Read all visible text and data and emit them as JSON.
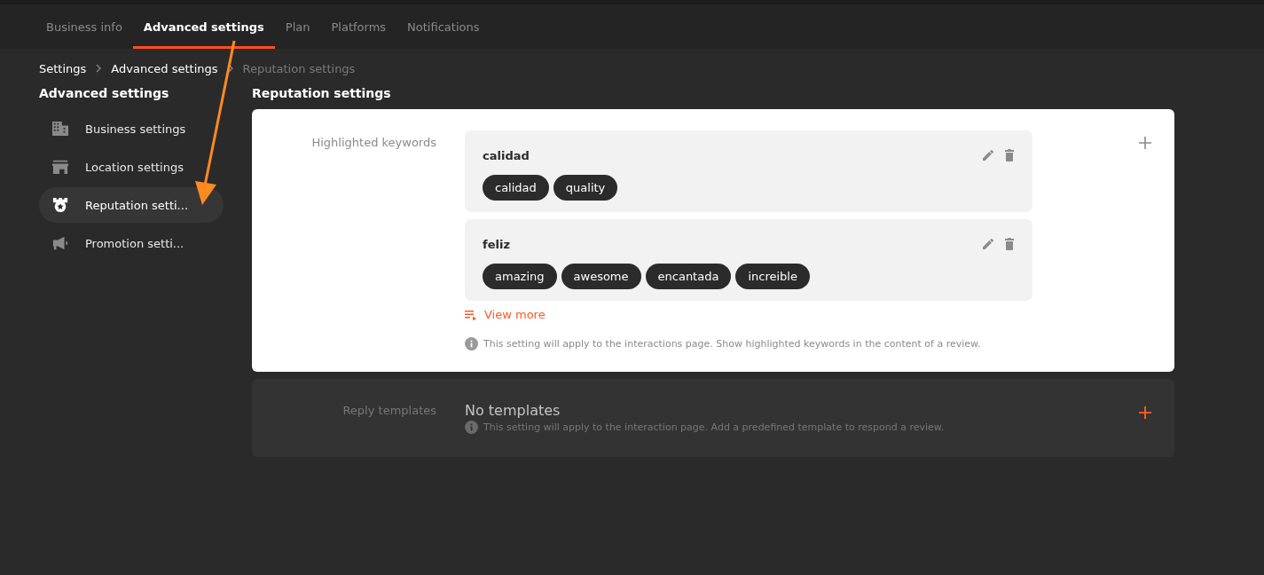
{
  "tabs": [
    {
      "label": "Business info",
      "selected": false
    },
    {
      "label": "Advanced settings",
      "selected": true
    },
    {
      "label": "Plan",
      "selected": false
    },
    {
      "label": "Platforms",
      "selected": false
    },
    {
      "label": "Notifications",
      "selected": false
    }
  ],
  "breadcrumb": [
    "Settings",
    "Advanced settings",
    "Reputation settings"
  ],
  "sidebar": {
    "title": "Advanced settings",
    "items": [
      {
        "label": "Business settings",
        "kind": "building",
        "selected": false
      },
      {
        "label": "Location settings",
        "kind": "store",
        "selected": false
      },
      {
        "label": "Reputation setti...",
        "kind": "badge",
        "selected": true
      },
      {
        "label": "Promotion setti...",
        "kind": "megaphone",
        "selected": false
      }
    ]
  },
  "main": {
    "title": "Reputation settings",
    "keywords": {
      "label": "Highlighted keywords",
      "groups": [
        {
          "name": "calidad",
          "tags": [
            "calidad",
            "quality"
          ]
        },
        {
          "name": "feliz",
          "tags": [
            "amazing",
            "awesome",
            "encantada",
            "increible"
          ]
        }
      ],
      "view_more": "View more",
      "hint": "This setting will apply to the interactions page. Show highlighted keywords in the content of a review."
    },
    "templates": {
      "label": "Reply templates",
      "empty": "No templates",
      "hint": "This setting will apply to the interaction page. Add a predefined template to respond a review."
    }
  }
}
